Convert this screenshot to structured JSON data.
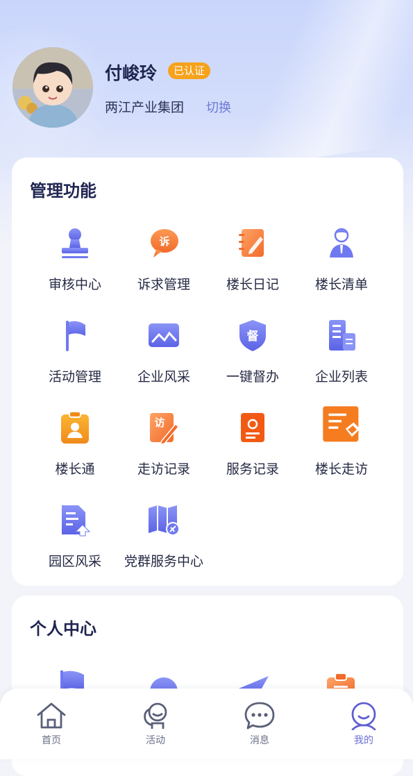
{
  "user": {
    "name": "付峻玲",
    "badge": "已认证",
    "company": "两江产业集团",
    "switch_label": "切换"
  },
  "management": {
    "title": "管理功能",
    "items": [
      {
        "label": "审核中心",
        "icon": "stamp-icon"
      },
      {
        "label": "诉求管理",
        "icon": "appeal-bubble-icon"
      },
      {
        "label": "楼长日记",
        "icon": "notebook-pen-icon"
      },
      {
        "label": "楼长清单",
        "icon": "manager-person-icon"
      },
      {
        "label": "活动管理",
        "icon": "flag-icon"
      },
      {
        "label": "企业风采",
        "icon": "landscape-image-icon"
      },
      {
        "label": "一键督办",
        "icon": "supervise-shield-icon"
      },
      {
        "label": "企业列表",
        "icon": "building-list-icon"
      },
      {
        "label": "楼长通",
        "icon": "id-badge-icon"
      },
      {
        "label": "走访记录",
        "icon": "visit-pen-icon"
      },
      {
        "label": "服务记录",
        "icon": "service-doc-icon"
      },
      {
        "label": "楼长走访",
        "icon": "handshake-note-icon"
      },
      {
        "label": "园区风采",
        "icon": "park-doc-icon"
      },
      {
        "label": "党群服务中心",
        "icon": "party-map-icon"
      }
    ]
  },
  "personal": {
    "title": "个人中心"
  },
  "tabbar": {
    "items": [
      {
        "label": "首页",
        "icon": "home-icon"
      },
      {
        "label": "活动",
        "icon": "activity-icon"
      },
      {
        "label": "消息",
        "icon": "message-icon"
      },
      {
        "label": "我的",
        "icon": "profile-icon"
      }
    ],
    "active": "我的"
  },
  "colors": {
    "accent": "#6b6fd6",
    "badge": "#f6a21b",
    "icon_blue": "#6f79f0",
    "icon_orange": "#f57c1f"
  }
}
